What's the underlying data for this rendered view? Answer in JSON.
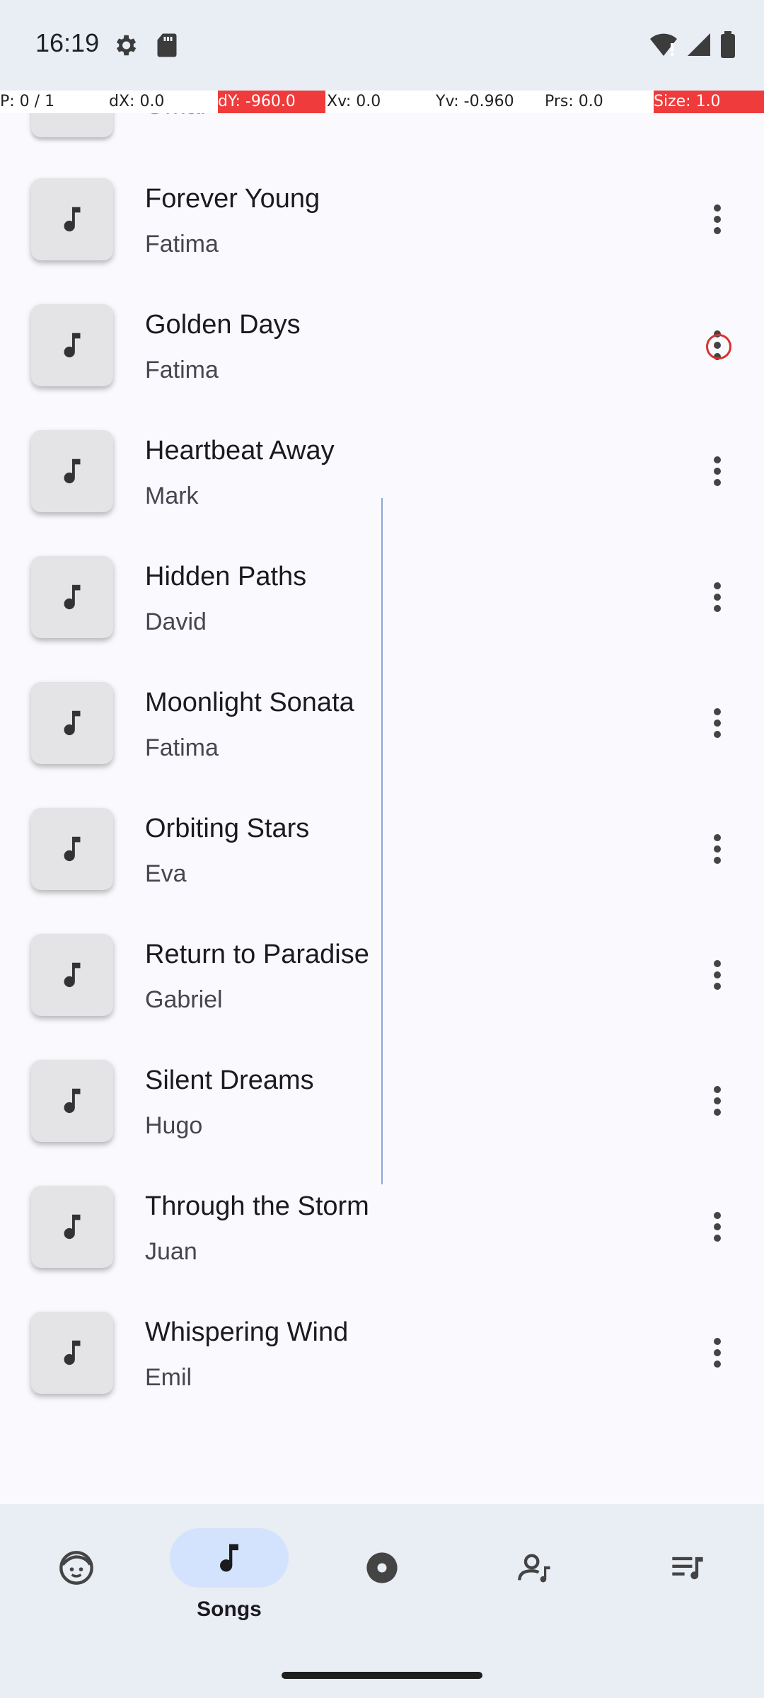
{
  "status_bar": {
    "time": "16:19"
  },
  "debug_overlay": {
    "pointer": "P: 0 / 1",
    "dx": "dX: 0.0",
    "dy": "dY: -960.0",
    "xv": "Xv: 0.0",
    "yv": "Yv: -0.960",
    "prs": "Prs: 0.0",
    "size": "Size: 1.0"
  },
  "partial_item": {
    "title": "Omar"
  },
  "songs": [
    {
      "title": "Forever Young",
      "artist": "Fatima"
    },
    {
      "title": "Golden Days",
      "artist": "Fatima"
    },
    {
      "title": "Heartbeat Away",
      "artist": "Mark"
    },
    {
      "title": "Hidden Paths",
      "artist": "David"
    },
    {
      "title": "Moonlight Sonata",
      "artist": "Fatima"
    },
    {
      "title": "Orbiting Stars",
      "artist": "Eva"
    },
    {
      "title": "Return to Paradise",
      "artist": "Gabriel"
    },
    {
      "title": "Silent Dreams",
      "artist": "Hugo"
    },
    {
      "title": "Through the Storm",
      "artist": "Juan"
    },
    {
      "title": "Whispering Wind",
      "artist": "Emil"
    }
  ],
  "icons": {
    "song_thumb": "music-note-icon",
    "more": "more-vert-icon",
    "nav_for_you": "face-icon",
    "nav_songs": "music-note-icon",
    "nav_albums": "album-icon",
    "nav_artists": "artist-icon",
    "nav_playlists": "playlist-icon"
  },
  "bottom_nav": {
    "active_label": "Songs"
  },
  "colors": {
    "accent_pill": "#d3e3fd",
    "highlight_ring": "#d9302f",
    "debug_red": "#ef3b3b"
  }
}
